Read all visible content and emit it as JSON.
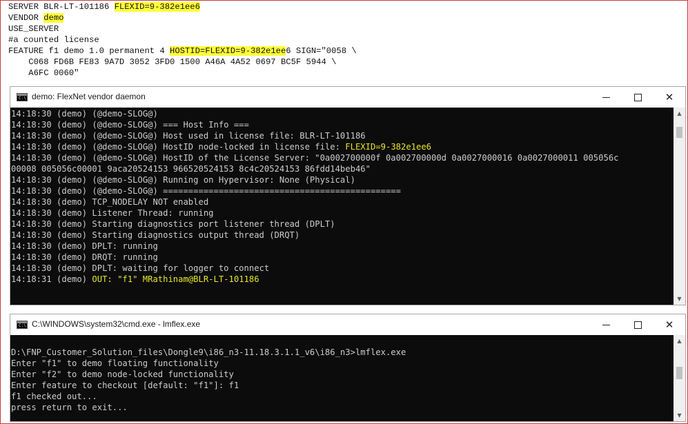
{
  "license": {
    "line1_pre": "SERVER BLR-LT-101186 ",
    "line1_hl": "FLEXID=9-382e1ee6",
    "line2_pre": "VENDOR ",
    "line2_hl": "demo",
    "line3": "USE_SERVER",
    "line4": "#a counted license",
    "line5_pre": "FEATURE f1 demo 1.0 permanent 4 ",
    "line5_hl": "HOSTID=FLEXID=9-382e1ee",
    "line5_post": "6 SIGN=\"0058 \\",
    "line6": "    C068 FD6B FE83 9A7D 3052 3FD0 1500 A46A 4A52 0697 BC5F 5944 \\",
    "line7": "    A6FC 0060\""
  },
  "daemon_window": {
    "title": "demo:  FlexNet vendor daemon",
    "minimize_label": "",
    "close_label": "✕",
    "lines": {
      "l1": "14:18:30 (demo) (@demo-SLOG@)",
      "l2": "14:18:30 (demo) (@demo-SLOG@) === Host Info ===",
      "l3": "14:18:30 (demo) (@demo-SLOG@) Host used in license file: BLR-LT-101186",
      "l4_pre": "14:18:30 (demo) (@demo-SLOG@) HostID node-locked in license file: ",
      "l4_hl": "FLEXID=9-382e1ee6",
      "l5": "14:18:30 (demo) (@demo-SLOG@) HostID of the License Server: \"0a002700000f 0a002700000d 0a0027000016 0a0027000011 005056c",
      "l6": "00008 005056c00001 9aca20524153 966520524153 8c4c20524153 86fdd14beb46\"",
      "l7": "14:18:30 (demo) (@demo-SLOG@) Running on Hypervisor: None (Physical)",
      "l8": "14:18:30 (demo) (@demo-SLOG@) ===============================================",
      "l9": "14:18:30 (demo) TCP_NODELAY NOT enabled",
      "l10": "14:18:30 (demo) Listener Thread: running",
      "l11": "14:18:30 (demo) Starting diagnostics port listener thread (DPLT)",
      "l12": "14:18:30 (demo) Starting diagnostics output thread (DRQT)",
      "l13": "14:18:30 (demo) DPLT: running",
      "l14": "14:18:30 (demo) DRQT: running",
      "l15": "14:18:30 (demo) DPLT: waiting for logger to connect",
      "l16_pre": "14:18:31 (demo) ",
      "l16_hl": "OUT: \"f1\" MRathinam@BLR-LT-101186"
    }
  },
  "cmd_window": {
    "title": "C:\\WINDOWS\\system32\\cmd.exe - lmflex.exe",
    "close_label": "✕",
    "lines": {
      "l1": "D:\\FNP_Customer_Solution_files\\Dongle9\\i86_n3-11.18.3.1.1_v6\\i86_n3>lmflex.exe",
      "l2": "Enter \"f1\" to demo floating functionality",
      "l3": "Enter \"f2\" to demo node-locked functionality",
      "l4": "Enter feature to checkout [default: \"f1\"]: f1",
      "l5": "f1 checked out...",
      "l6": "press return to exit..."
    }
  },
  "colors": {
    "highlight": "#ffff3a",
    "console_text": "#cccccc",
    "console_yellow": "#e5e52a",
    "console_bg": "#0c0c0c"
  }
}
